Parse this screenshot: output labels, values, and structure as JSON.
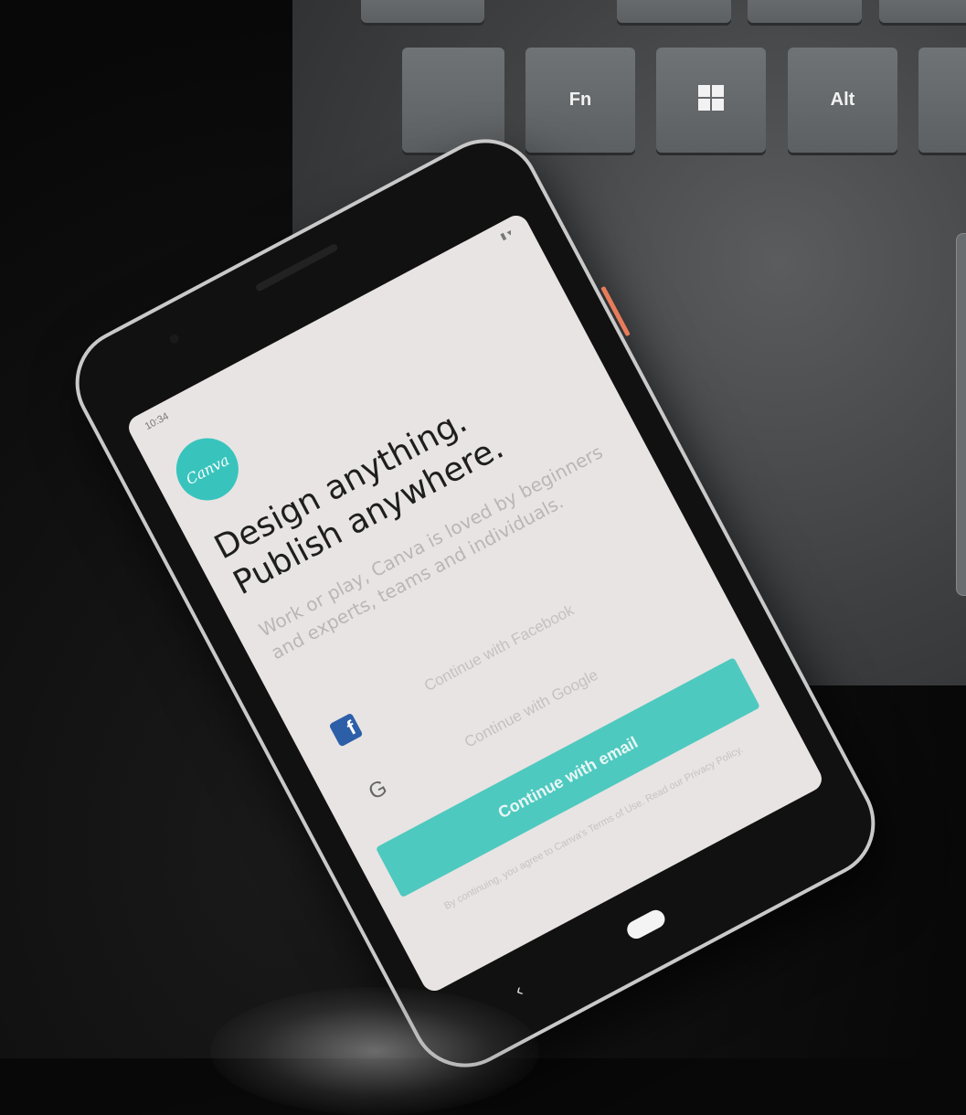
{
  "keyboard": {
    "keys": [
      "",
      "Fn",
      "",
      "Alt",
      ""
    ],
    "icons": [
      "windows-icon"
    ]
  },
  "phone": {
    "status_time": "10:34",
    "app": {
      "logo_text": "Canva",
      "headline_line1": "Design anything.",
      "headline_line2": "Publish anywhere.",
      "subtitle": "Work or play, Canva is loved by beginners and experts, teams and individuals.",
      "facebook_button": "Continue with Facebook",
      "google_button": "Continue with Google",
      "email_button": "Continue with email",
      "legal_text": "By continuing, you agree to Canva's Terms of Use. Read our Privacy Policy."
    },
    "colors": {
      "accent": "#38c4bd",
      "button": "#4ec9bf",
      "facebook": "#2d5fa8"
    }
  }
}
